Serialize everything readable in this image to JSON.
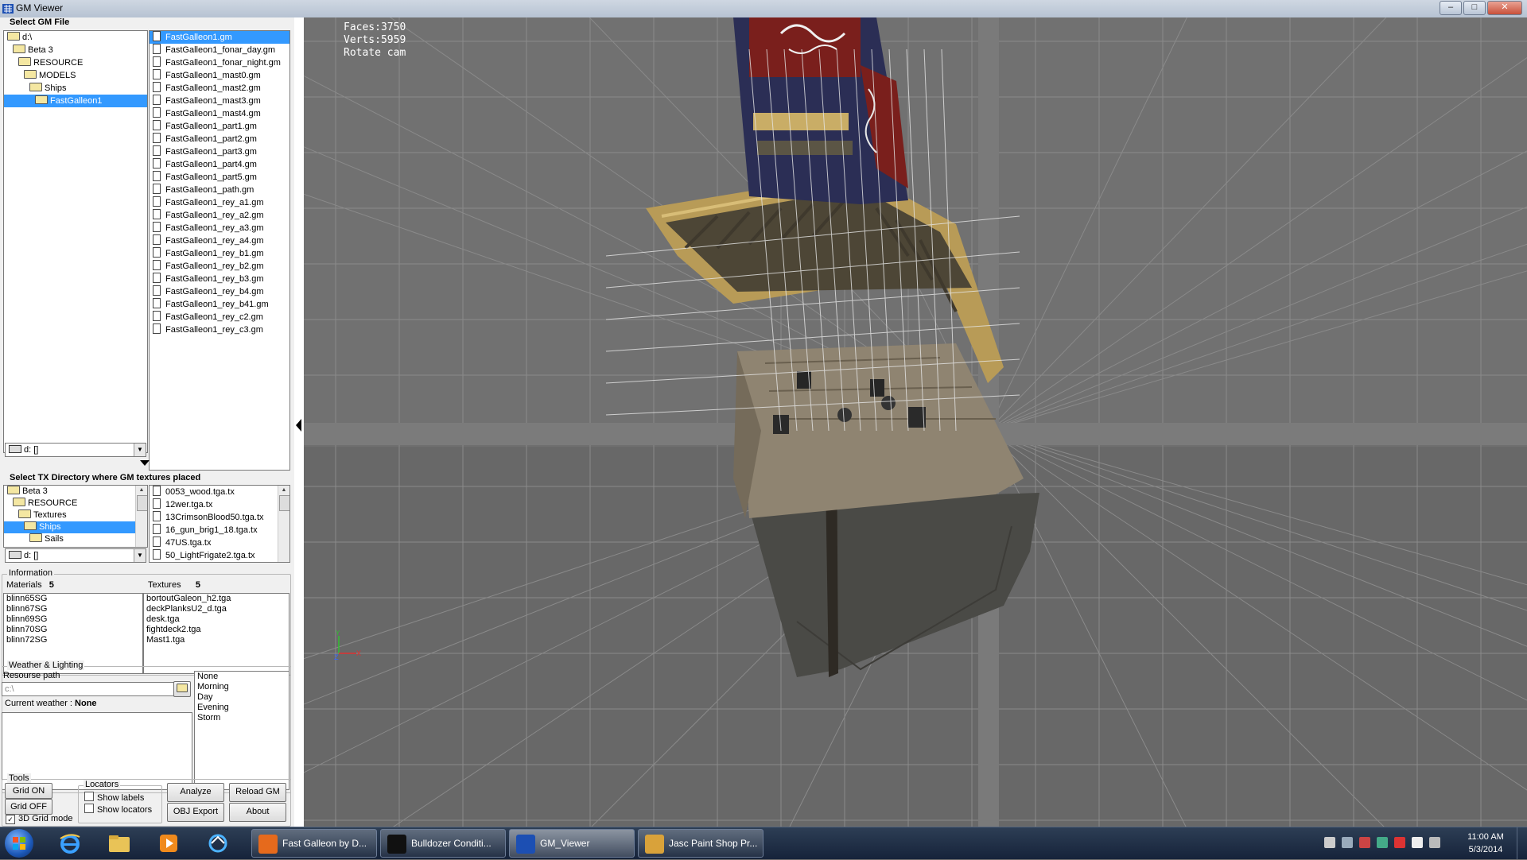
{
  "window": {
    "title": "GM Viewer",
    "min": "–",
    "max": "□",
    "close": "✕"
  },
  "gm_section": {
    "title": "Select GM File",
    "folders": [
      {
        "label": "d:\\",
        "depth": 0,
        "selected": false
      },
      {
        "label": "Beta 3",
        "depth": 1,
        "selected": false
      },
      {
        "label": "RESOURCE",
        "depth": 2,
        "selected": false
      },
      {
        "label": "MODELS",
        "depth": 3,
        "selected": false
      },
      {
        "label": "Ships",
        "depth": 4,
        "selected": false
      },
      {
        "label": "FastGalleon1",
        "depth": 5,
        "selected": true
      }
    ],
    "drive": "d: []",
    "files": [
      "FastGalleon1.gm",
      "FastGalleon1_fonar_day.gm",
      "FastGalleon1_fonar_night.gm",
      "FastGalleon1_mast0.gm",
      "FastGalleon1_mast2.gm",
      "FastGalleon1_mast3.gm",
      "FastGalleon1_mast4.gm",
      "FastGalleon1_part1.gm",
      "FastGalleon1_part2.gm",
      "FastGalleon1_part3.gm",
      "FastGalleon1_part4.gm",
      "FastGalleon1_part5.gm",
      "FastGalleon1_path.gm",
      "FastGalleon1_rey_a1.gm",
      "FastGalleon1_rey_a2.gm",
      "FastGalleon1_rey_a3.gm",
      "FastGalleon1_rey_a4.gm",
      "FastGalleon1_rey_b1.gm",
      "FastGalleon1_rey_b2.gm",
      "FastGalleon1_rey_b3.gm",
      "FastGalleon1_rey_b4.gm",
      "FastGalleon1_rey_b41.gm",
      "FastGalleon1_rey_c2.gm",
      "FastGalleon1_rey_c3.gm"
    ],
    "selected_file_index": 0
  },
  "tx_section": {
    "title": "Select TX Directory where GM textures placed",
    "folders": [
      {
        "label": "Beta 3",
        "depth": 0,
        "selected": false
      },
      {
        "label": "RESOURCE",
        "depth": 1,
        "selected": false
      },
      {
        "label": "Textures",
        "depth": 2,
        "selected": false
      },
      {
        "label": "Ships",
        "depth": 3,
        "selected": true
      },
      {
        "label": "Sails",
        "depth": 4,
        "selected": false
      }
    ],
    "drive": "d: []",
    "files": [
      "0053_wood.tga.tx",
      "12wer.tga.tx",
      "13CrimsonBlood50.tga.tx",
      "16_gun_brig1_18.tga.tx",
      "47US.tga.tx",
      "50_LightFrigate2.tga.tx"
    ]
  },
  "information": {
    "title": "Information",
    "materials_label": "Materials",
    "materials_count": "5",
    "textures_label": "Textures",
    "textures_count": "5",
    "materials": [
      "blinn65SG",
      "blinn67SG",
      "blinn69SG",
      "blinn70SG",
      "blinn72SG"
    ],
    "textures": [
      "bortoutGaleon_h2.tga",
      "deckPlanksU2_d.tga",
      "desk.tga",
      "fightdeck2.tga",
      "Mast1.tga"
    ]
  },
  "weather": {
    "title": "Weather & Lighting",
    "resource_path_label": "Resourse path",
    "resource_path_value": "c:\\",
    "current_weather_label": "Current weather :",
    "current_weather_value": "None",
    "options": [
      "None",
      "Morning",
      "Day",
      "Evening",
      "Storm"
    ]
  },
  "tools": {
    "title": "Tools",
    "grid_on": "Grid ON",
    "grid_off": "Grid OFF",
    "grid_3d": "3D Grid mode",
    "grid_3d_checked": true,
    "locators_title": "Locators",
    "show_labels": "Show labels",
    "show_locators": "Show locators",
    "analyze": "Analyze",
    "reload": "Reload GM",
    "obj_export": "OBJ Export",
    "about": "About"
  },
  "viewport": {
    "faces": "Faces:3750",
    "verts": "Verts:5959",
    "mode": "Rotate cam",
    "axis_x": "X",
    "axis_y": "Y",
    "axis_z": "Z",
    "colors": {
      "axis_x": "#e03030",
      "axis_y": "#30c030",
      "axis_z": "#3060ff"
    }
  },
  "taskbar": {
    "pinned_icons": [
      "internet-explorer-icon",
      "folder-icon",
      "media-player-icon",
      "sync-icon"
    ],
    "tasks": [
      {
        "label": "Fast Galleon by D...",
        "icon": "firefox-icon",
        "active": false
      },
      {
        "label": "Bulldozer Conditi...",
        "icon": "crosshair-icon",
        "active": false
      },
      {
        "label": "GM_Viewer",
        "icon": "gm-viewer-icon",
        "active": true
      },
      {
        "label": "Jasc Paint Shop Pr...",
        "icon": "paint-shop-icon",
        "active": false
      }
    ],
    "time": "11:00 AM",
    "date": "5/3/2014"
  }
}
